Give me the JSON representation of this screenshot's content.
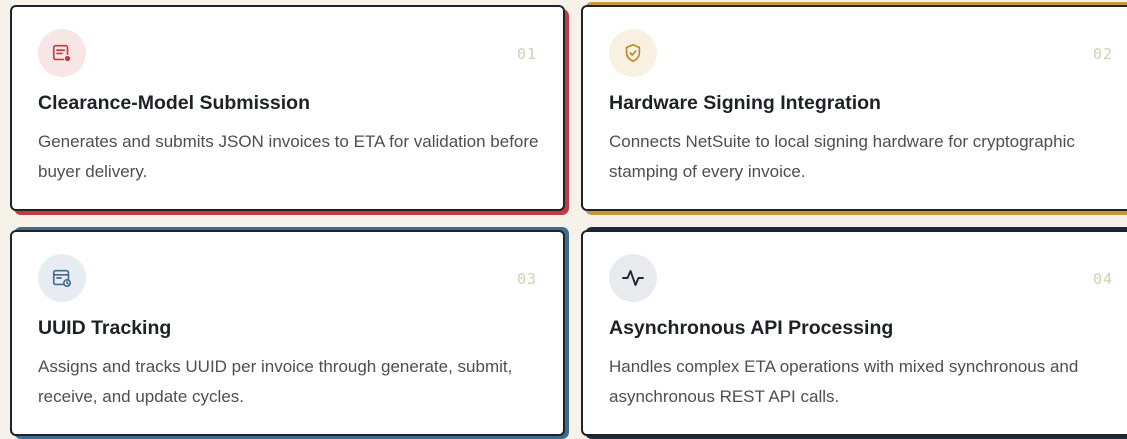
{
  "cards": [
    {
      "number": "01",
      "title": "Clearance-Model Submission",
      "description": "Generates and submits JSON invoices to ETA for validation before buyer delivery.",
      "icon": "invoice-check-icon",
      "accent": "#c13b44",
      "icon_bg": "#f8e6e6",
      "icon_color": "#c13b44"
    },
    {
      "number": "02",
      "title": "Hardware Signing Integration",
      "description": "Connects NetSuite to local signing hardware for cryptographic stamping of every invoice.",
      "icon": "shield-check-icon",
      "accent": "#c49a35",
      "icon_bg": "#f8f1e2",
      "icon_color": "#b8892a"
    },
    {
      "number": "03",
      "title": "UUID Tracking",
      "description": "Assigns and tracks UUID per invoice through generate, submit, receive, and update cycles.",
      "icon": "document-clock-icon",
      "accent": "#3f6b8e",
      "icon_bg": "#e6ecf1",
      "icon_color": "#3f6b8e"
    },
    {
      "number": "04",
      "title": "Asynchronous API Processing",
      "description": "Handles complex ETA operations with mixed synchronous and asynchronous REST API calls.",
      "icon": "activity-pulse-icon",
      "accent": "#1d2a3b",
      "icon_bg": "#e8eaed",
      "icon_color": "#1d2a3b"
    }
  ]
}
